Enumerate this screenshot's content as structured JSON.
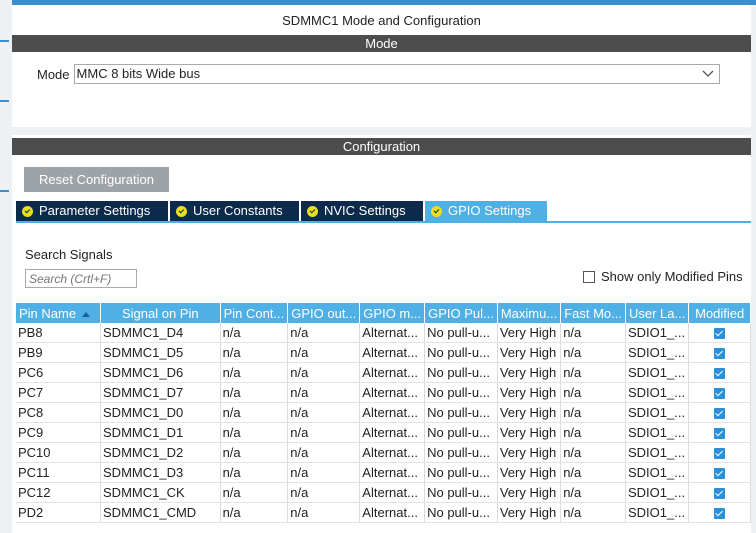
{
  "window": {
    "title": "SDMMC1 Mode and Configuration"
  },
  "mode_section": {
    "header": "Mode",
    "label": "Mode",
    "selected": "MMC 8 bits Wide bus"
  },
  "config_section": {
    "header": "Configuration",
    "reset_label": "Reset Configuration",
    "tabs": [
      {
        "label": "Parameter Settings",
        "active": false
      },
      {
        "label": "User Constants",
        "active": false
      },
      {
        "label": "NVIC Settings",
        "active": false
      },
      {
        "label": "GPIO Settings",
        "active": true
      }
    ]
  },
  "search": {
    "label": "Search Signals",
    "placeholder": "Search (Crtl+F)",
    "show_modified_label": "Show only Modified Pins",
    "show_modified_checked": false
  },
  "table": {
    "columns": [
      "Pin Name",
      "Signal on Pin",
      "Pin Cont...",
      "GPIO out...",
      "GPIO m...",
      "GPIO Pul...",
      "Maximu...",
      "Fast Mo...",
      "User La...",
      "Modified"
    ],
    "rows": [
      [
        "PB8",
        "SDMMC1_D4",
        "n/a",
        "n/a",
        "Alternat...",
        "No pull-u...",
        "Very High",
        "n/a",
        "SDIO1_..."
      ],
      [
        "PB9",
        "SDMMC1_D5",
        "n/a",
        "n/a",
        "Alternat...",
        "No pull-u...",
        "Very High",
        "n/a",
        "SDIO1_..."
      ],
      [
        "PC6",
        "SDMMC1_D6",
        "n/a",
        "n/a",
        "Alternat...",
        "No pull-u...",
        "Very High",
        "n/a",
        "SDIO1_..."
      ],
      [
        "PC7",
        "SDMMC1_D7",
        "n/a",
        "n/a",
        "Alternat...",
        "No pull-u...",
        "Very High",
        "n/a",
        "SDIO1_..."
      ],
      [
        "PC8",
        "SDMMC1_D0",
        "n/a",
        "n/a",
        "Alternat...",
        "No pull-u...",
        "Very High",
        "n/a",
        "SDIO1_..."
      ],
      [
        "PC9",
        "SDMMC1_D1",
        "n/a",
        "n/a",
        "Alternat...",
        "No pull-u...",
        "Very High",
        "n/a",
        "SDIO1_..."
      ],
      [
        "PC10",
        "SDMMC1_D2",
        "n/a",
        "n/a",
        "Alternat...",
        "No pull-u...",
        "Very High",
        "n/a",
        "SDIO1_..."
      ],
      [
        "PC11",
        "SDMMC1_D3",
        "n/a",
        "n/a",
        "Alternat...",
        "No pull-u...",
        "Very High",
        "n/a",
        "SDIO1_..."
      ],
      [
        "PC12",
        "SDMMC1_CK",
        "n/a",
        "n/a",
        "Alternat...",
        "No pull-u...",
        "Very High",
        "n/a",
        "SDIO1_..."
      ],
      [
        "PD2",
        "SDMMC1_CMD",
        "n/a",
        "n/a",
        "Alternat...",
        "No pull-u...",
        "Very High",
        "n/a",
        "SDIO1_..."
      ]
    ],
    "modified": [
      true,
      true,
      true,
      true,
      true,
      true,
      true,
      true,
      true,
      true
    ]
  },
  "colors": {
    "section_bar": "#4d4d4d",
    "header_blue": "#4fb0e6",
    "tab_dark": "#0d2a4d",
    "check_yellow": "#e8e01c",
    "checkbox_blue": "#2a90d8"
  }
}
